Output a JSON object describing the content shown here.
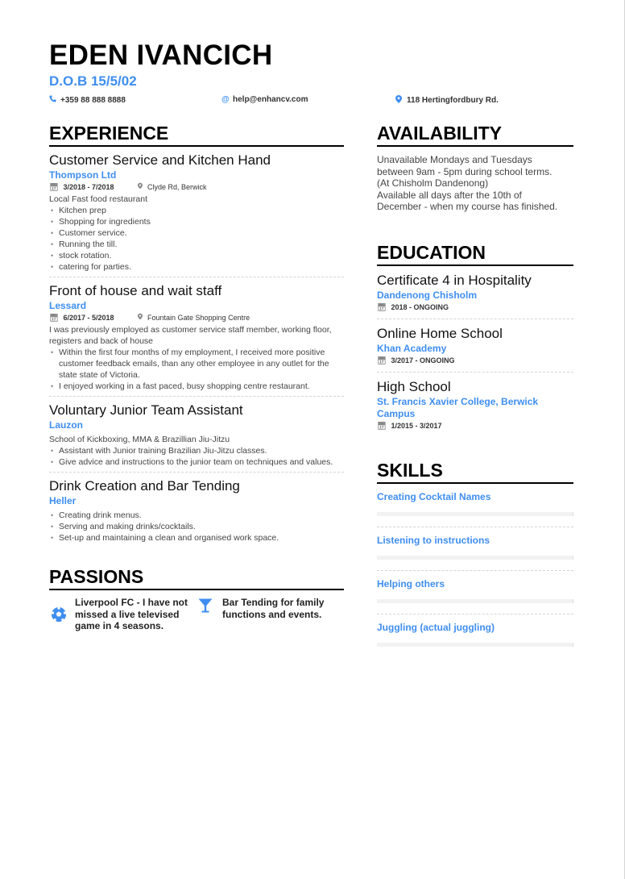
{
  "header": {
    "name": "EDEN IVANCICH",
    "subtitle": "D.O.B 15/5/02",
    "phone": "+359 88 888 8888",
    "email": "help@enhancv.com",
    "address": "118 Hertingfordbury Rd.",
    "icons": {
      "phone": "phone-icon",
      "email": "at-icon",
      "address": "map-pin-icon"
    }
  },
  "experience": {
    "title": "EXPERIENCE",
    "items": [
      {
        "role": "Customer Service and Kitchen Hand",
        "company": "Thompson Ltd",
        "dates": "3/2018 - 7/2018",
        "location": "Clyde Rd, Berwick",
        "description": "Local Fast food restaurant",
        "bullets": [
          "Kitchen prep",
          "Shopping for ingredients",
          "Customer service.",
          "Running the till.",
          "stock rotation.",
          "catering for parties."
        ]
      },
      {
        "role": "Front of house and wait staff",
        "company": "Lessard",
        "dates": "6/2017 - 5/2018",
        "location": "Fountain Gate Shopping Centre",
        "description": "I was previously employed as customer service staff member, working floor, registers and back of house",
        "bullets": [
          "Within the first four months of my employment,  I received more positive customer feedback emails, than any other employee in any outlet for the state state of Victoria.",
          "I enjoyed working in a fast paced, busy shopping centre restaurant."
        ]
      },
      {
        "role": "Voluntary Junior Team Assistant",
        "company": "Lauzon",
        "description": "School of Kickboxing, MMA & Brazillian Jiu-Jitzu",
        "bullets": [
          "Assistant with Junior training Brazilian Jiu-Jitzu classes.",
          "Give advice and instructions to the junior team on techniques and values."
        ]
      },
      {
        "role": "Drink Creation and Bar Tending",
        "company": "Heller",
        "bullets": [
          "Creating drink menus.",
          "Serving and making drinks/cocktails.",
          "Set-up and maintaining a clean and organised work space."
        ]
      }
    ]
  },
  "passions": {
    "title": "PASSIONS",
    "items": [
      {
        "icon": "soccer-ball-icon",
        "text": "Liverpool FC - I have not missed a live televised game in 4 seasons."
      },
      {
        "icon": "cocktail-glass-icon",
        "text": "Bar Tending for family functions and events."
      }
    ]
  },
  "availability": {
    "title": "AVAILABILITY",
    "text": "Unavailable Mondays and Tuesdays\nbetween 9am - 5pm during school terms.\n(At Chisholm Dandenong)\nAvailable all days after the 10th of\nDecember - when my course has finished."
  },
  "education": {
    "title": "EDUCATION",
    "items": [
      {
        "degree": "Certificate 4 in Hospitality",
        "school": "Dandenong Chisholm",
        "dates": "2018 - ONGOING"
      },
      {
        "degree": "Online Home School",
        "school": "Khan Academy",
        "dates": "3/2017 - ONGOING"
      },
      {
        "degree": "High School",
        "school": "St. Francis Xavier College, Berwick Campus",
        "dates": "1/2015 - 3/2017"
      }
    ]
  },
  "skills": {
    "title": "SKILLS",
    "items": [
      {
        "name": "Creating Cocktail Names",
        "level": 0
      },
      {
        "name": "Listening to instructions",
        "level": 0
      },
      {
        "name": "Helping others",
        "level": 0
      },
      {
        "name": "Juggling (actual juggling)",
        "level": 0
      }
    ]
  },
  "colors": {
    "accent": "#3f8ef0",
    "text": "#222222",
    "divider": "#d4d4d4"
  }
}
